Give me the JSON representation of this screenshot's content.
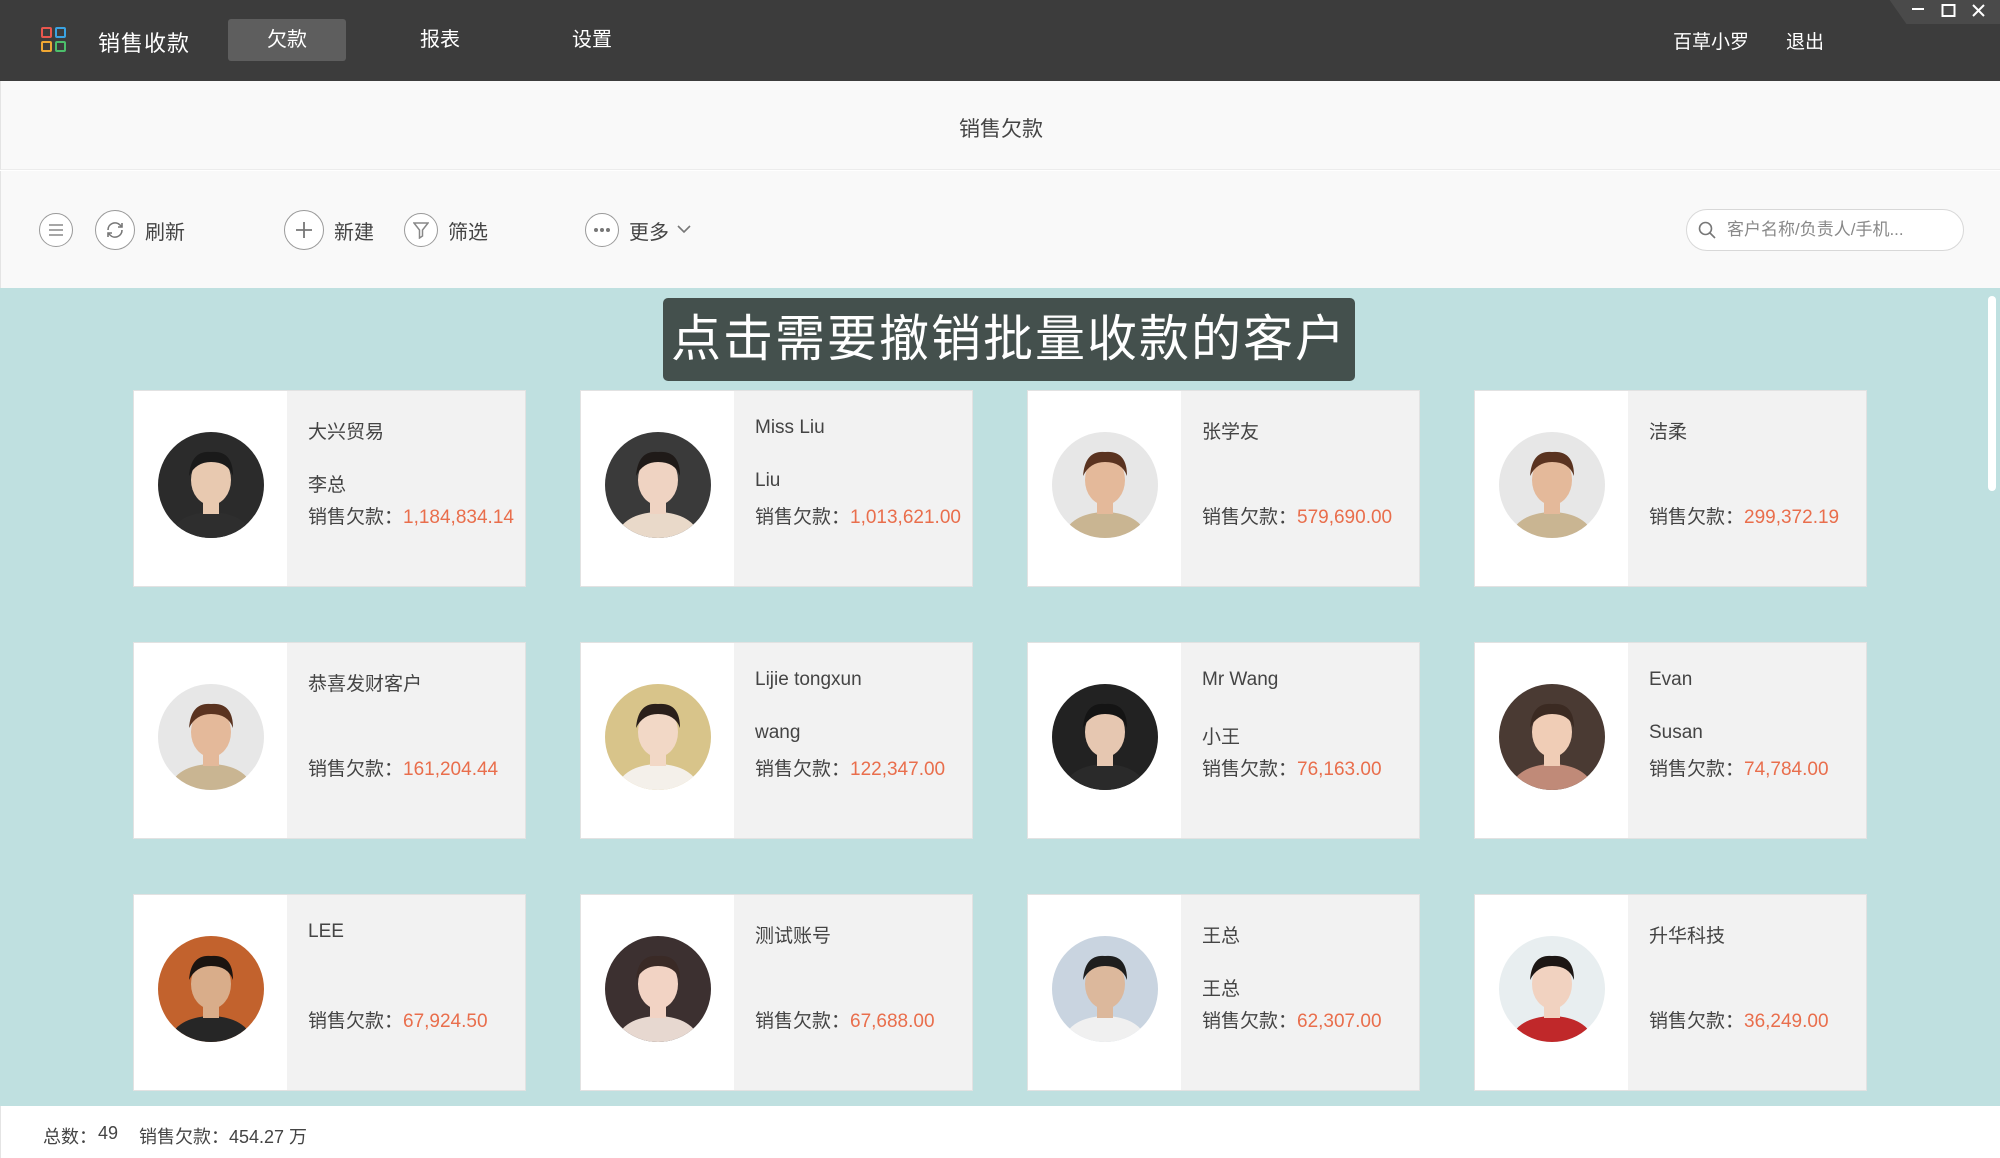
{
  "app": {
    "name": "销售收款",
    "nav_tabs": [
      "欠款",
      "报表",
      "设置"
    ],
    "active_tab": "欠款",
    "user": "百草小罗",
    "logout": "退出"
  },
  "page": {
    "title": "销售欠款"
  },
  "toolbar": {
    "refresh": "刷新",
    "new": "新建",
    "filter": "筛选",
    "more": "更多",
    "search_placeholder": "客户名称/负责人/手机..."
  },
  "hint": "点击需要撤销批量收款的客户",
  "debt_label": "销售欠款：",
  "customers": [
    {
      "name": "大兴贸易",
      "contact": "李总",
      "debt": "1,184,834.14",
      "avatar_bg": "#2b2b2b",
      "avatar_skin": "#e8c9b0",
      "avatar_hair": "#1a1a1a",
      "avatar_shirt": "#2e2e2e"
    },
    {
      "name": "Miss Liu",
      "contact": "Liu",
      "debt": "1,013,621.00",
      "avatar_bg": "#3a3a3a",
      "avatar_skin": "#efd3c2",
      "avatar_hair": "#1f1a18",
      "avatar_shirt": "#e9d9c9"
    },
    {
      "name": "张学友",
      "contact": "",
      "debt": "579,690.00",
      "avatar_bg": "#e7e7e7",
      "avatar_skin": "#e4b99a",
      "avatar_hair": "#5a3320",
      "avatar_shirt": "#c9b592"
    },
    {
      "name": "洁柔",
      "contact": "",
      "debt": "299,372.19",
      "avatar_bg": "#e7e7e7",
      "avatar_skin": "#e4b99a",
      "avatar_hair": "#5a3320",
      "avatar_shirt": "#c9b592"
    },
    {
      "name": "恭喜发财客户",
      "contact": "",
      "debt": "161,204.44",
      "avatar_bg": "#e7e7e7",
      "avatar_skin": "#e4b99a",
      "avatar_hair": "#5a3320",
      "avatar_shirt": "#c9b592"
    },
    {
      "name": "Lijie tongxun",
      "contact": "wang",
      "debt": "122,347.00",
      "avatar_bg": "#d8c48a",
      "avatar_skin": "#f2d8c6",
      "avatar_hair": "#2a1f1a",
      "avatar_shirt": "#f4f0ea"
    },
    {
      "name": "Mr Wang",
      "contact": "小王",
      "debt": "76,163.00",
      "avatar_bg": "#222222",
      "avatar_skin": "#e6c7b1",
      "avatar_hair": "#141414",
      "avatar_shirt": "#2a2a2a"
    },
    {
      "name": "Evan",
      "contact": "Susan",
      "debt": "74,784.00",
      "avatar_bg": "#4a3a33",
      "avatar_skin": "#f0cdb6",
      "avatar_hair": "#3b2a22",
      "avatar_shirt": "#c08a78"
    },
    {
      "name": "LEE",
      "contact": "",
      "debt": "67,924.50",
      "avatar_bg": "#c2622d",
      "avatar_skin": "#d9ad8a",
      "avatar_hair": "#1b1410",
      "avatar_shirt": "#262626"
    },
    {
      "name": "测试账号",
      "contact": "",
      "debt": "67,688.00",
      "avatar_bg": "#3c3030",
      "avatar_skin": "#f2d3c4",
      "avatar_hair": "#3a2a26",
      "avatar_shirt": "#e7d8d0"
    },
    {
      "name": "王总",
      "contact": "王总",
      "debt": "62,307.00",
      "avatar_bg": "#c9d4e0",
      "avatar_skin": "#dcb89c",
      "avatar_hair": "#1e1e1e",
      "avatar_shirt": "#f0f0f0"
    },
    {
      "name": "升华科技",
      "contact": "",
      "debt": "36,249.00",
      "avatar_bg": "#e8eef0",
      "avatar_skin": "#f1d2c0",
      "avatar_hair": "#1c1614",
      "avatar_shirt": "#c0282a"
    }
  ],
  "footer": {
    "total_label": "总数：",
    "total_value": "49",
    "sum_label": "销售欠款：",
    "sum_value": "454.27 万"
  }
}
